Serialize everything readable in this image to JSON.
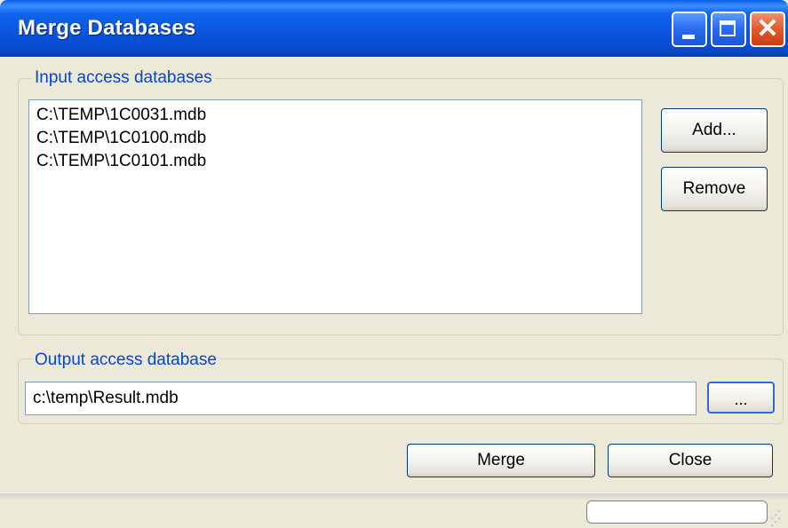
{
  "window": {
    "title": "Merge Databases"
  },
  "input_group": {
    "label": "Input access databases",
    "items": [
      "C:\\TEMP\\1C0031.mdb",
      "C:\\TEMP\\1C0100.mdb",
      "C:\\TEMP\\1C0101.mdb"
    ],
    "add_label": "Add...",
    "remove_label": "Remove"
  },
  "output_group": {
    "label": "Output access database",
    "value": "c:\\temp\\Result.mdb",
    "browse_label": "..."
  },
  "actions": {
    "merge_label": "Merge",
    "close_label": "Close"
  },
  "icons": {
    "minimize": "minimize-icon",
    "maximize": "maximize-icon",
    "close": "close-icon",
    "grip": "resize-grip-icon"
  }
}
